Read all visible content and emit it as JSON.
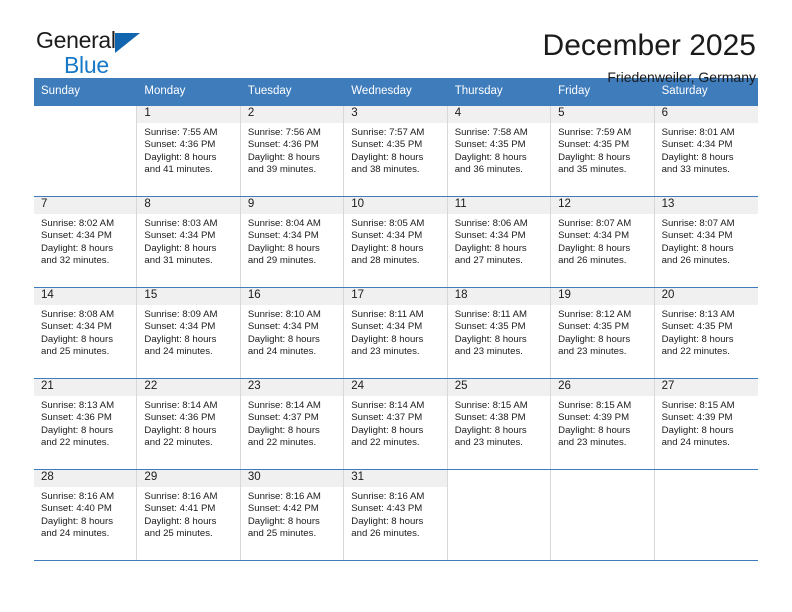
{
  "brand": {
    "name_part1": "General",
    "name_part2": "Blue",
    "accent_color": "#1164ae",
    "text_color": "#1878c8"
  },
  "header": {
    "title": "December 2025",
    "subtitle": "Friedenweiler, Germany",
    "header_bg": "#3e7cbc"
  },
  "weekdays": [
    "Sunday",
    "Monday",
    "Tuesday",
    "Wednesday",
    "Thursday",
    "Friday",
    "Saturday"
  ],
  "weeks": [
    [
      {
        "day": "",
        "lines": []
      },
      {
        "day": "1",
        "lines": [
          "Sunrise: 7:55 AM",
          "Sunset: 4:36 PM",
          "Daylight: 8 hours",
          "and 41 minutes."
        ]
      },
      {
        "day": "2",
        "lines": [
          "Sunrise: 7:56 AM",
          "Sunset: 4:36 PM",
          "Daylight: 8 hours",
          "and 39 minutes."
        ]
      },
      {
        "day": "3",
        "lines": [
          "Sunrise: 7:57 AM",
          "Sunset: 4:35 PM",
          "Daylight: 8 hours",
          "and 38 minutes."
        ]
      },
      {
        "day": "4",
        "lines": [
          "Sunrise: 7:58 AM",
          "Sunset: 4:35 PM",
          "Daylight: 8 hours",
          "and 36 minutes."
        ]
      },
      {
        "day": "5",
        "lines": [
          "Sunrise: 7:59 AM",
          "Sunset: 4:35 PM",
          "Daylight: 8 hours",
          "and 35 minutes."
        ]
      },
      {
        "day": "6",
        "lines": [
          "Sunrise: 8:01 AM",
          "Sunset: 4:34 PM",
          "Daylight: 8 hours",
          "and 33 minutes."
        ]
      }
    ],
    [
      {
        "day": "7",
        "lines": [
          "Sunrise: 8:02 AM",
          "Sunset: 4:34 PM",
          "Daylight: 8 hours",
          "and 32 minutes."
        ]
      },
      {
        "day": "8",
        "lines": [
          "Sunrise: 8:03 AM",
          "Sunset: 4:34 PM",
          "Daylight: 8 hours",
          "and 31 minutes."
        ]
      },
      {
        "day": "9",
        "lines": [
          "Sunrise: 8:04 AM",
          "Sunset: 4:34 PM",
          "Daylight: 8 hours",
          "and 29 minutes."
        ]
      },
      {
        "day": "10",
        "lines": [
          "Sunrise: 8:05 AM",
          "Sunset: 4:34 PM",
          "Daylight: 8 hours",
          "and 28 minutes."
        ]
      },
      {
        "day": "11",
        "lines": [
          "Sunrise: 8:06 AM",
          "Sunset: 4:34 PM",
          "Daylight: 8 hours",
          "and 27 minutes."
        ]
      },
      {
        "day": "12",
        "lines": [
          "Sunrise: 8:07 AM",
          "Sunset: 4:34 PM",
          "Daylight: 8 hours",
          "and 26 minutes."
        ]
      },
      {
        "day": "13",
        "lines": [
          "Sunrise: 8:07 AM",
          "Sunset: 4:34 PM",
          "Daylight: 8 hours",
          "and 26 minutes."
        ]
      }
    ],
    [
      {
        "day": "14",
        "lines": [
          "Sunrise: 8:08 AM",
          "Sunset: 4:34 PM",
          "Daylight: 8 hours",
          "and 25 minutes."
        ]
      },
      {
        "day": "15",
        "lines": [
          "Sunrise: 8:09 AM",
          "Sunset: 4:34 PM",
          "Daylight: 8 hours",
          "and 24 minutes."
        ]
      },
      {
        "day": "16",
        "lines": [
          "Sunrise: 8:10 AM",
          "Sunset: 4:34 PM",
          "Daylight: 8 hours",
          "and 24 minutes."
        ]
      },
      {
        "day": "17",
        "lines": [
          "Sunrise: 8:11 AM",
          "Sunset: 4:34 PM",
          "Daylight: 8 hours",
          "and 23 minutes."
        ]
      },
      {
        "day": "18",
        "lines": [
          "Sunrise: 8:11 AM",
          "Sunset: 4:35 PM",
          "Daylight: 8 hours",
          "and 23 minutes."
        ]
      },
      {
        "day": "19",
        "lines": [
          "Sunrise: 8:12 AM",
          "Sunset: 4:35 PM",
          "Daylight: 8 hours",
          "and 23 minutes."
        ]
      },
      {
        "day": "20",
        "lines": [
          "Sunrise: 8:13 AM",
          "Sunset: 4:35 PM",
          "Daylight: 8 hours",
          "and 22 minutes."
        ]
      }
    ],
    [
      {
        "day": "21",
        "lines": [
          "Sunrise: 8:13 AM",
          "Sunset: 4:36 PM",
          "Daylight: 8 hours",
          "and 22 minutes."
        ]
      },
      {
        "day": "22",
        "lines": [
          "Sunrise: 8:14 AM",
          "Sunset: 4:36 PM",
          "Daylight: 8 hours",
          "and 22 minutes."
        ]
      },
      {
        "day": "23",
        "lines": [
          "Sunrise: 8:14 AM",
          "Sunset: 4:37 PM",
          "Daylight: 8 hours",
          "and 22 minutes."
        ]
      },
      {
        "day": "24",
        "lines": [
          "Sunrise: 8:14 AM",
          "Sunset: 4:37 PM",
          "Daylight: 8 hours",
          "and 22 minutes."
        ]
      },
      {
        "day": "25",
        "lines": [
          "Sunrise: 8:15 AM",
          "Sunset: 4:38 PM",
          "Daylight: 8 hours",
          "and 23 minutes."
        ]
      },
      {
        "day": "26",
        "lines": [
          "Sunrise: 8:15 AM",
          "Sunset: 4:39 PM",
          "Daylight: 8 hours",
          "and 23 minutes."
        ]
      },
      {
        "day": "27",
        "lines": [
          "Sunrise: 8:15 AM",
          "Sunset: 4:39 PM",
          "Daylight: 8 hours",
          "and 24 minutes."
        ]
      }
    ],
    [
      {
        "day": "28",
        "lines": [
          "Sunrise: 8:16 AM",
          "Sunset: 4:40 PM",
          "Daylight: 8 hours",
          "and 24 minutes."
        ]
      },
      {
        "day": "29",
        "lines": [
          "Sunrise: 8:16 AM",
          "Sunset: 4:41 PM",
          "Daylight: 8 hours",
          "and 25 minutes."
        ]
      },
      {
        "day": "30",
        "lines": [
          "Sunrise: 8:16 AM",
          "Sunset: 4:42 PM",
          "Daylight: 8 hours",
          "and 25 minutes."
        ]
      },
      {
        "day": "31",
        "lines": [
          "Sunrise: 8:16 AM",
          "Sunset: 4:43 PM",
          "Daylight: 8 hours",
          "and 26 minutes."
        ]
      },
      {
        "day": "",
        "lines": []
      },
      {
        "day": "",
        "lines": []
      },
      {
        "day": "",
        "lines": []
      }
    ]
  ]
}
